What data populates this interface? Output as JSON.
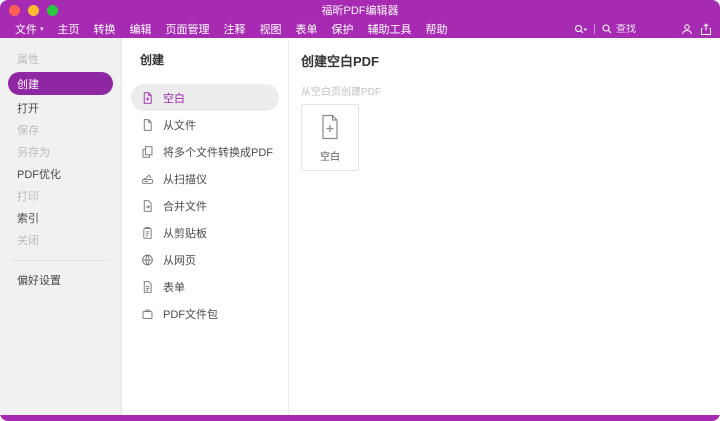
{
  "window": {
    "title": "福昕PDF编辑器"
  },
  "menubar": {
    "items": [
      "文件",
      "主页",
      "转换",
      "编辑",
      "页面管理",
      "注释",
      "视图",
      "表单",
      "保护",
      "辅助工具",
      "帮助"
    ],
    "search_placeholder": "查找",
    "icons": [
      "search-dropdown-icon",
      "search-icon",
      "account-icon",
      "share-icon"
    ]
  },
  "sidebar": {
    "items": [
      {
        "label": "属性",
        "state": "disabled"
      },
      {
        "label": "创建",
        "state": "selected"
      },
      {
        "label": "打开",
        "state": "normal"
      },
      {
        "label": "保存",
        "state": "disabled"
      },
      {
        "label": "另存为",
        "state": "disabled"
      },
      {
        "label": "PDF优化",
        "state": "normal"
      },
      {
        "label": "打印",
        "state": "disabled"
      },
      {
        "label": "索引",
        "state": "normal"
      },
      {
        "label": "关闭",
        "state": "disabled"
      }
    ],
    "footer": {
      "label": "偏好设置"
    }
  },
  "create_panel": {
    "title": "创建",
    "items": [
      {
        "label": "空白",
        "icon": "blank-document-icon",
        "selected": true
      },
      {
        "label": "从文件",
        "icon": "file-icon",
        "selected": false
      },
      {
        "label": "将多个文件转换成PDF",
        "icon": "multiple-files-icon",
        "selected": false
      },
      {
        "label": "从扫描仪",
        "icon": "scanner-icon",
        "selected": false
      },
      {
        "label": "合并文件",
        "icon": "combine-files-icon",
        "selected": false
      },
      {
        "label": "从剪贴板",
        "icon": "clipboard-icon",
        "selected": false
      },
      {
        "label": "从网页",
        "icon": "web-globe-icon",
        "selected": false
      },
      {
        "label": "表单",
        "icon": "form-icon",
        "selected": false
      },
      {
        "label": "PDF文件包",
        "icon": "portfolio-icon",
        "selected": false
      }
    ]
  },
  "content": {
    "title": "创建空白PDF",
    "subtitle": "从空白页创建PDF",
    "card_label": "空白"
  },
  "colors": {
    "titlebar": "#A62BB2",
    "sidebar_selected": "#8F27A3",
    "accent_text": "#9C27B0",
    "list_selected_bg": "#ECECEC"
  }
}
